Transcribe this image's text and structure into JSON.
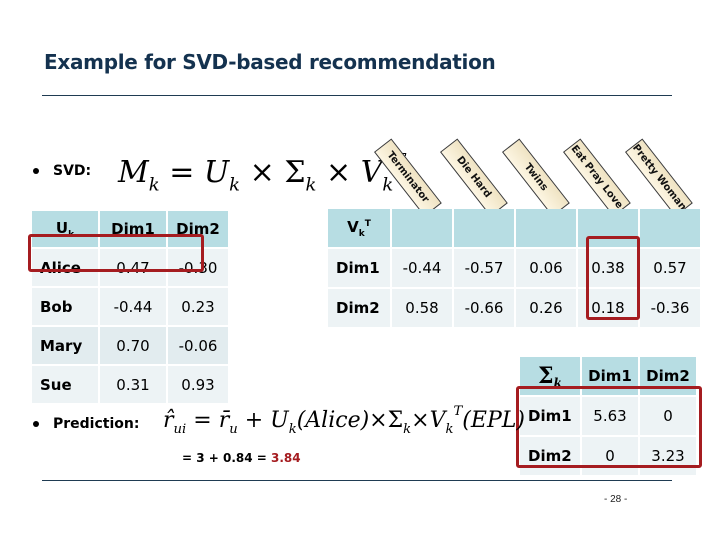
{
  "slide": {
    "title": "Example for SVD-based recommendation",
    "page_number": "- 28 -"
  },
  "svd": {
    "label": "SVD:",
    "formula": {
      "lhs": "M",
      "lhs_sub": "k",
      "eq": "=",
      "u": "U",
      "u_sub": "k",
      "times1": "×",
      "sigma": "Σ",
      "sigma_sub": "k",
      "times2": "×",
      "v": "V",
      "v_sub": "k",
      "v_sup": "T"
    }
  },
  "uk_table": {
    "header": {
      "corner": "U",
      "corner_sub": "k",
      "cols": [
        "Dim1",
        "Dim2"
      ]
    },
    "rows": [
      {
        "name": "Alice",
        "values": [
          "0.47",
          "-0.30"
        ],
        "highlighted": true
      },
      {
        "name": "Bob",
        "values": [
          "-0.44",
          "0.23"
        ]
      },
      {
        "name": "Mary",
        "values": [
          "0.70",
          "-0.06"
        ]
      },
      {
        "name": "Sue",
        "values": [
          "0.31",
          "0.93"
        ]
      }
    ]
  },
  "vk_table": {
    "header": {
      "corner": "V",
      "corner_sub": "k",
      "corner_sup": "T"
    },
    "movies": [
      "Terminator",
      "Die Hard",
      "Twins",
      "Eat Pray Love",
      "Pretty Woman"
    ],
    "rows": [
      {
        "name": "Dim1",
        "values": [
          "-0.44",
          "-0.57",
          "0.06",
          "0.38",
          "0.57"
        ]
      },
      {
        "name": "Dim2",
        "values": [
          "0.58",
          "-0.66",
          "0.26",
          "0.18",
          "-0.36"
        ]
      }
    ],
    "highlighted_column": "Eat Pray Love"
  },
  "sigma_table": {
    "header": {
      "corner": "Σ",
      "corner_sub": "k",
      "cols": [
        "Dim1",
        "Dim2"
      ]
    },
    "rows": [
      {
        "name": "Dim1",
        "values": [
          "5.63",
          "0"
        ]
      },
      {
        "name": "Dim2",
        "values": [
          "0",
          "3.23"
        ]
      }
    ]
  },
  "prediction": {
    "label": "Prediction:",
    "formula": {
      "r": "r̂",
      "r_sub": "ui",
      "eq": "=",
      "rbar": "r̄",
      "rbar_sub": "u",
      "plus": "+",
      "u": "U",
      "u_sub": "k",
      "u_arg": "(Alice)",
      "times1": "×",
      "sigma": "Σ",
      "sigma_sub": "k",
      "times2": "×",
      "v": "V",
      "v_sub": "k",
      "v_sup": "T",
      "v_arg": "(EPL)"
    },
    "calc_prefix": "= 3 + 0.84 = ",
    "result": "3.84"
  },
  "colors": {
    "title": "#14324f",
    "highlight": "#a51c20",
    "header_cell": "#b7dde3",
    "body_cell": "#edf3f5"
  }
}
